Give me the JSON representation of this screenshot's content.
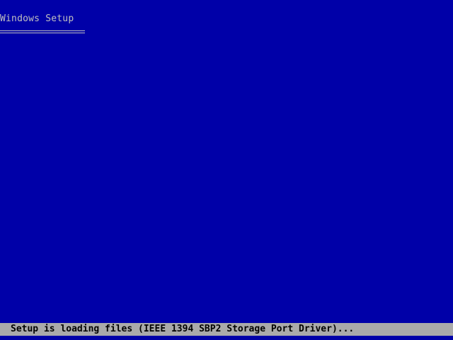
{
  "header": {
    "title": "Windows Setup"
  },
  "status_bar": {
    "text": "Setup is loading files (IEEE 1394 SBP2 Storage Port Driver)..."
  },
  "colors": {
    "background": "#0000a8",
    "header_text": "#c0c0c0",
    "status_bar_background": "#aaaaaa",
    "status_text": "#000000"
  }
}
